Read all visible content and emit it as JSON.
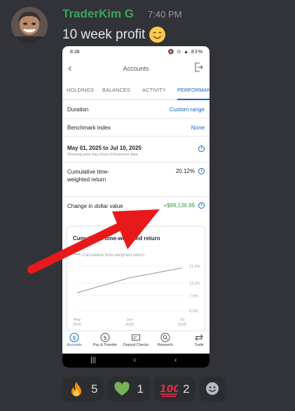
{
  "message": {
    "author": "TraderKim G",
    "time": "7:40 PM",
    "text": "10 week profit",
    "text_emoji": "smiling-face-icon"
  },
  "phone": {
    "status_time": "8:38",
    "appbar_title": "Accounts",
    "tabs": [
      {
        "label": "HOLDINGS",
        "active": false
      },
      {
        "label": "BALANCES",
        "active": false
      },
      {
        "label": "ACTIVITY",
        "active": false
      },
      {
        "label": "PERFORMANCE",
        "active": true
      }
    ],
    "duration_label": "Duration",
    "duration_value": "Custom range",
    "benchmark_label": "Benchmark index",
    "benchmark_value": "None",
    "date_range": "May 01, 2025 to Jul 10, 2025",
    "date_note": "Showing prior day close-of-business data",
    "cumulative_label": "Cumulative time-weighted return",
    "cumulative_value": "20.12%",
    "dollar_label": "Change in dollar value",
    "dollar_value": "+$99,136.89",
    "card_title": "Cumulative time-weighted return",
    "bottom_nav": [
      {
        "label": "Accounts",
        "icon": "dollar-circle-icon",
        "active": true
      },
      {
        "label": "Pay & Transfer",
        "icon": "transfer-icon",
        "active": false
      },
      {
        "label": "Deposit Checks",
        "icon": "check-deposit-icon",
        "active": false
      },
      {
        "label": "Research",
        "icon": "research-icon",
        "active": false
      },
      {
        "label": "Trade",
        "icon": "trade-icon",
        "active": false
      }
    ],
    "accent": "#1565c0",
    "gain_color": "#2e9e3c"
  },
  "chart_data": {
    "type": "line",
    "title": "Cumulative time-weighted return",
    "legend": [
      "Cumulative time-weighted return"
    ],
    "x": [
      "May 2025",
      "Jun 2025",
      "Jul 2025"
    ],
    "xlabel": "",
    "ylabel": "",
    "y_ticks": [
      "21.0%",
      "13.0%",
      "7.0%",
      "0.0%"
    ],
    "y_tick_values": [
      21.0,
      13.0,
      7.0,
      0.0
    ],
    "series": [
      {
        "name": "Cumulative time-weighted return",
        "values": [
          8.5,
          15.5,
          20.12
        ]
      }
    ],
    "ylim": [
      0,
      21
    ],
    "grid": true,
    "line_color": "#a08a8a"
  },
  "reactions": [
    {
      "emoji": "fire-icon",
      "count": "5"
    },
    {
      "emoji": "green-heart-icon",
      "count": "1"
    },
    {
      "emoji": "hundred-points-icon",
      "count": "2"
    }
  ],
  "add_reaction_icon": "add-reaction-icon",
  "arrow_color": "#e8191b"
}
